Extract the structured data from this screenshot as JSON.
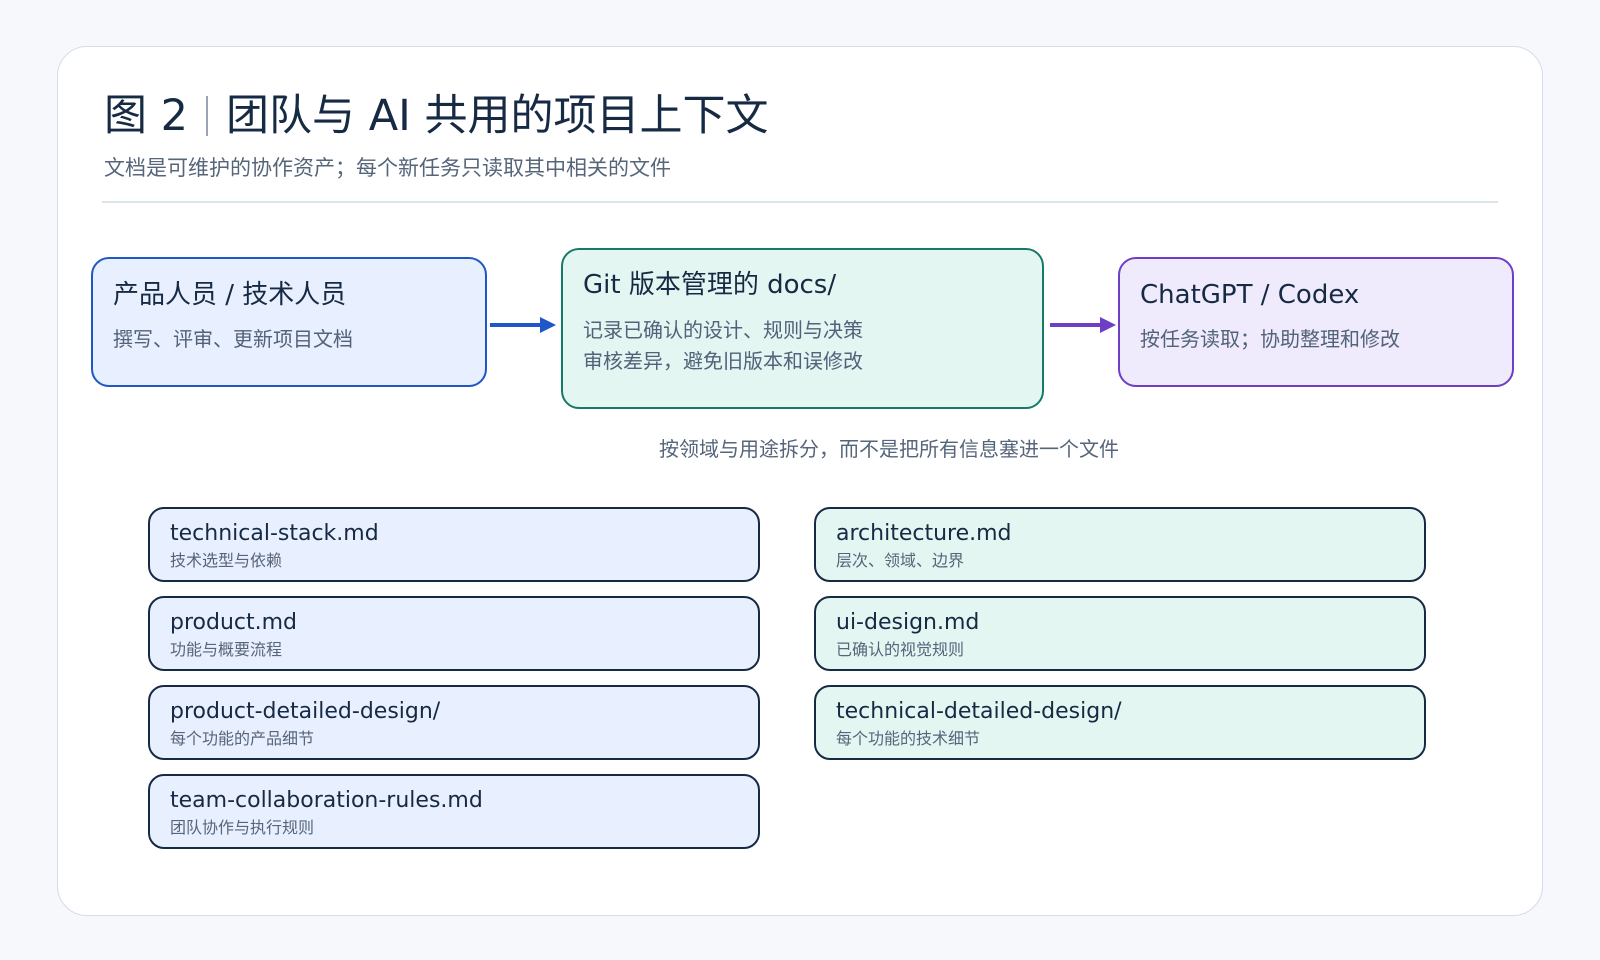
{
  "header": {
    "fig_label": "图 2",
    "title": "团队与 AI 共用的项目上下文",
    "subtitle": "文档是可维护的协作资产；每个新任务只读取其中相关的文件"
  },
  "flow": {
    "people": {
      "title": "产品人员 / 技术人员",
      "desc": "撰写、评审、更新项目文档"
    },
    "docs": {
      "title": "Git 版本管理的 docs/",
      "line1": "记录已确认的设计、规则与决策",
      "line2": "审核差异，避免旧版本和误修改"
    },
    "ai": {
      "title": "ChatGPT / Codex",
      "desc": "按任务读取；协助整理和修改"
    }
  },
  "caption": "按领域与用途拆分，而不是把所有信息塞进一个文件",
  "files_left": [
    {
      "name": "technical-stack.md",
      "desc": "技术选型与依赖"
    },
    {
      "name": "product.md",
      "desc": "功能与概要流程"
    },
    {
      "name": "product-detailed-design/",
      "desc": "每个功能的产品细节"
    },
    {
      "name": "team-collaboration-rules.md",
      "desc": "团队协作与执行规则"
    }
  ],
  "files_right": [
    {
      "name": "architecture.md",
      "desc": "层次、领域、边界"
    },
    {
      "name": "ui-design.md",
      "desc": "已确认的视觉规则"
    },
    {
      "name": "technical-detailed-design/",
      "desc": "每个功能的技术细节"
    }
  ],
  "colors": {
    "blue_fill": "#e8efff",
    "blue_border": "#1f56c8",
    "green_fill": "#e3f6f2",
    "green_border": "#167a69",
    "purple_fill": "#efeafc",
    "purple_border": "#6c3fc6"
  }
}
